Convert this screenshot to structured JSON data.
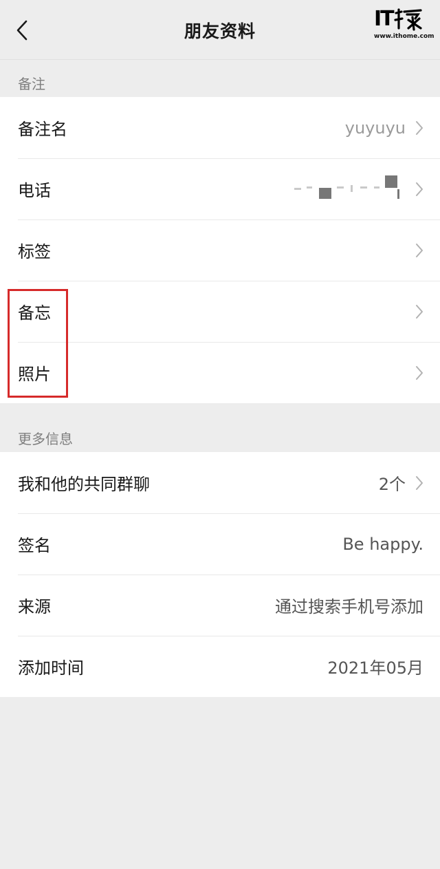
{
  "header": {
    "title": "朋友资料",
    "logo_text": "IT之家",
    "logo_url": "www.ithome.com"
  },
  "sections": [
    {
      "label": "备注",
      "rows": [
        {
          "label": "备注名",
          "value": "yuyuyu",
          "chevron": true
        },
        {
          "label": "电话",
          "value": "",
          "chevron": true
        },
        {
          "label": "标签",
          "value": "",
          "chevron": true
        },
        {
          "label": "备忘",
          "value": "",
          "chevron": true
        },
        {
          "label": "照片",
          "value": "",
          "chevron": true
        }
      ]
    },
    {
      "label": "更多信息",
      "rows": [
        {
          "label": "我和他的共同群聊",
          "value": "2个",
          "chevron": true
        },
        {
          "label": "签名",
          "value": "Be happy.",
          "chevron": false
        },
        {
          "label": "来源",
          "value": "通过搜索手机号添加",
          "chevron": false
        },
        {
          "label": "添加时间",
          "value": "2021年05月",
          "chevron": false
        }
      ]
    }
  ],
  "colors": {
    "background": "#ededed",
    "card": "#ffffff",
    "highlight_box": "#d62a2a",
    "secondary_text": "#9a9a9a"
  }
}
